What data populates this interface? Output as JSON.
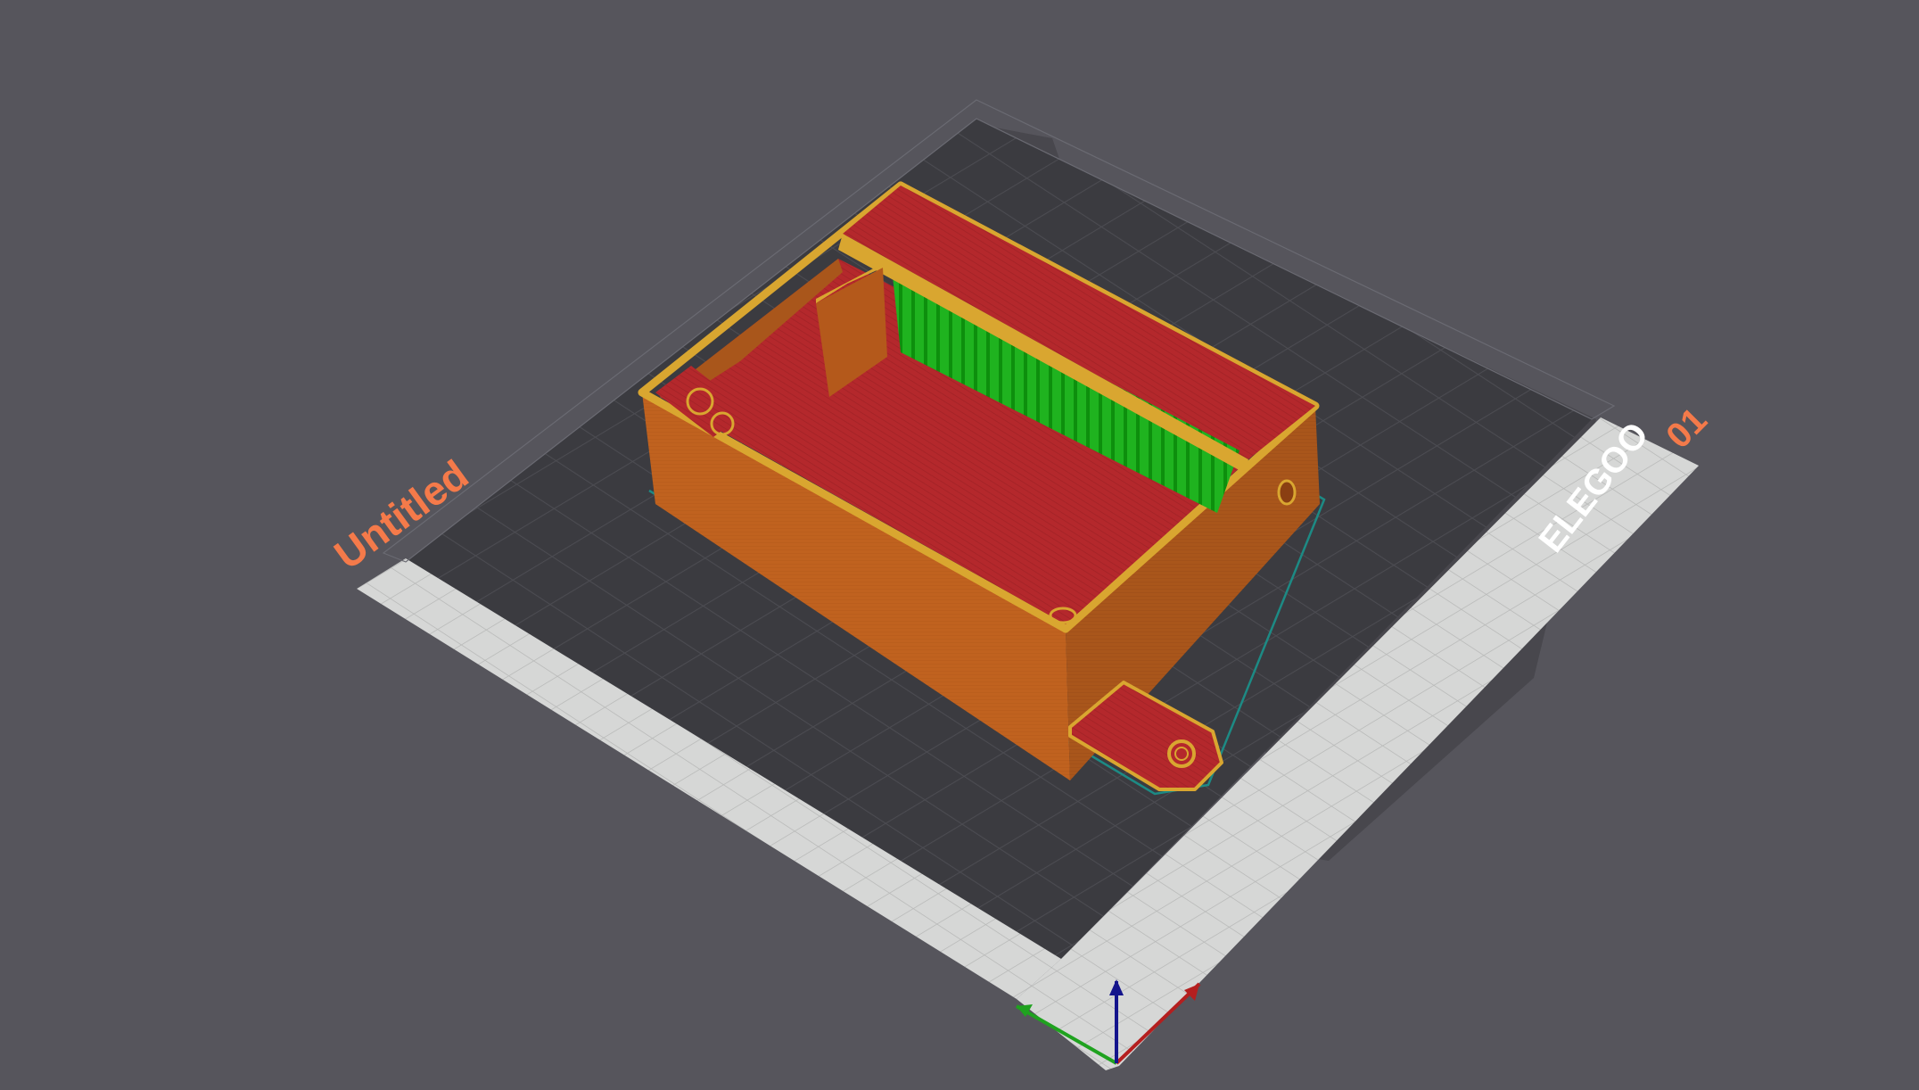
{
  "scene": {
    "project_name": "Untitled",
    "bed_brand": "ELEGOO",
    "plate_number": "01",
    "colors": {
      "background": "#56555c",
      "bed_dark": "#3b3b40",
      "bed_light": "#d6d7d6",
      "grid_line": "#4c4c52",
      "label_accent": "#f47a4a",
      "wall": "#c0621f",
      "wall_shadow": "#9a4c18",
      "wall_edge": "#d9a630",
      "solid_infill": "#b4282c",
      "support": "#1fb31f",
      "skirt": "#1d8a84",
      "axis_x": "#b41f1f",
      "axis_y": "#1fa21f",
      "axis_z": "#14148c"
    },
    "axes": [
      {
        "name": "x-axis"
      },
      {
        "name": "y-axis"
      },
      {
        "name": "z-axis"
      }
    ]
  }
}
